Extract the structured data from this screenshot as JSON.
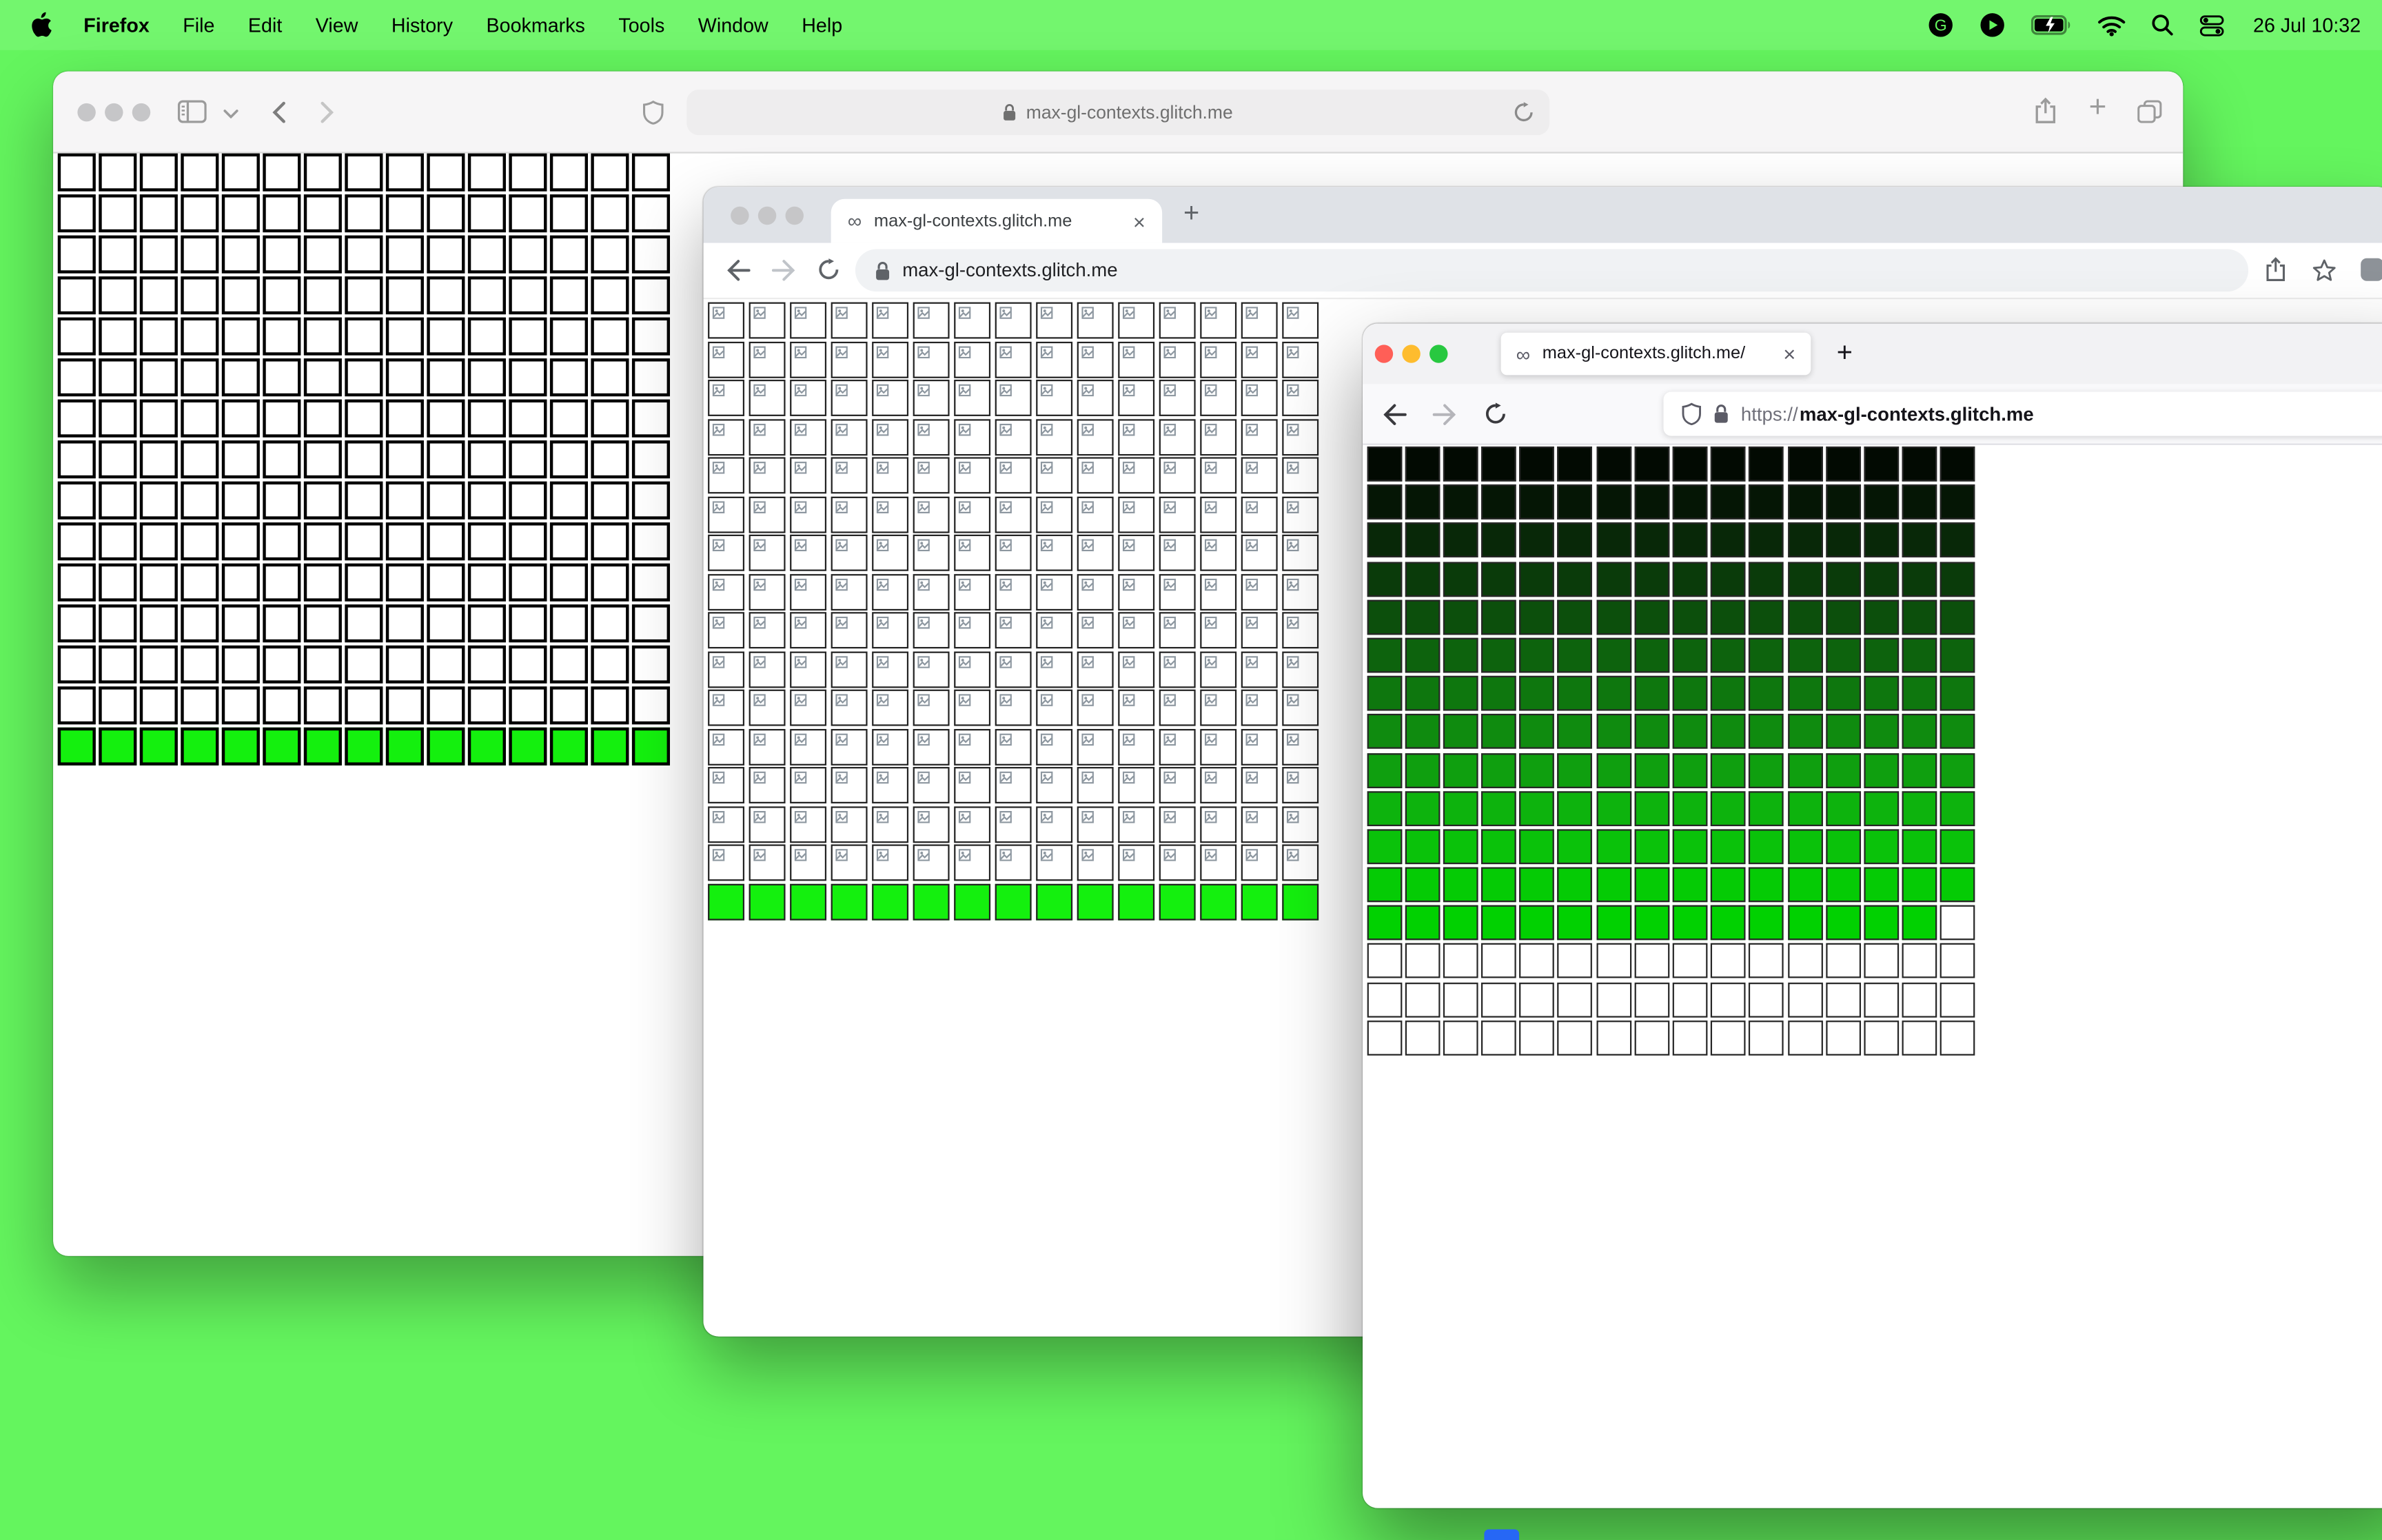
{
  "desktop": {
    "background": "#64f55e",
    "dock_peek_color": "#2667f5"
  },
  "menubar": {
    "app_name": "Firefox",
    "menus": [
      "File",
      "Edit",
      "View",
      "History",
      "Bookmarks",
      "Tools",
      "Window",
      "Help"
    ],
    "clock": "26 Jul 10:32"
  },
  "safari_window": {
    "url": "max-gl-contexts.glitch.me",
    "new_tab_label": "+",
    "grid": {
      "kind": "plain",
      "cols": 15,
      "white_rows": 14,
      "green_color": "#14f00e",
      "cell_border": "#000000"
    }
  },
  "chrome_window": {
    "favicon": "∞",
    "tab_title": "max-gl-contexts.glitch.me",
    "close_label": "×",
    "new_tab_label": "+",
    "url": "max-gl-contexts.glitch.me",
    "grid": {
      "kind": "broken",
      "cols": 15,
      "broken_rows": 15,
      "green_color": "#14f00e",
      "cell_border": "#222222"
    }
  },
  "firefox_window": {
    "favicon": "∞",
    "tab_title": "max-gl-contexts.glitch.me/",
    "close_label": "×",
    "new_tab_label": "+",
    "url_scheme": "https://",
    "url_host": "max-gl-contexts.glitch.me",
    "grid": {
      "kind": "gradient",
      "cols": 16,
      "row_colors": [
        "#020a02",
        "#051605",
        "#082808",
        "#0a3b0a",
        "#0c4f0c",
        "#0d630d",
        "#0e770e",
        "#0f8b0f",
        "#0f9f0f",
        "#0db30d",
        "#0ac20a",
        "#05cb05",
        "#01d101"
      ],
      "last_gradient_row_last_cell_white": true,
      "white_rows": 3,
      "cell_border": "#262626"
    }
  }
}
